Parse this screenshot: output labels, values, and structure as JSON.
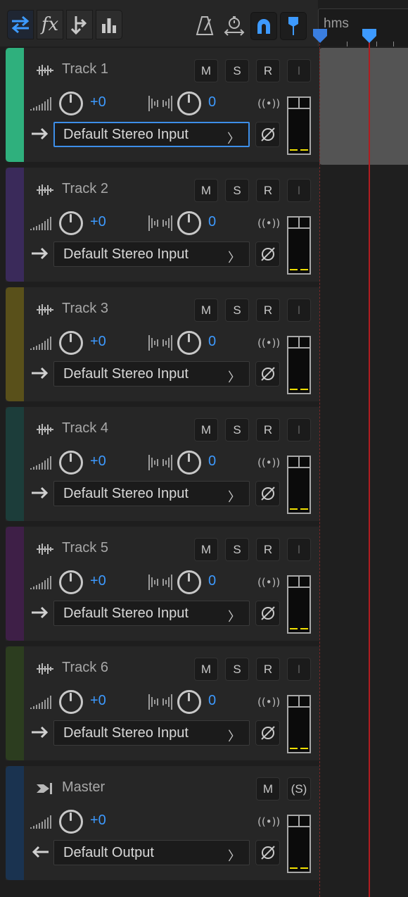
{
  "toolbar": {
    "tools": [
      {
        "name": "switch-view-icon",
        "active": true
      },
      {
        "name": "fx-icon",
        "label": "fx"
      },
      {
        "name": "sends-icon"
      },
      {
        "name": "eq-icon"
      }
    ],
    "right_tools": [
      "metronome-icon",
      "time-stretch-icon",
      "snap-magnet-icon",
      "marker-pin-icon"
    ]
  },
  "ruler": {
    "label": "hms"
  },
  "colors": {
    "accent": "#3d9aff",
    "playhead": "#b01c20",
    "meter_level": "#f0e000"
  },
  "tracks": [
    {
      "name": "Track 1",
      "color": "#2fb07d",
      "mute": "M",
      "solo": "S",
      "record": "R",
      "input_monitor": "I",
      "volume": "+0",
      "pan": "0",
      "input": "Default Stereo Input"
    },
    {
      "name": "Track 2",
      "color": "#3a2a5a",
      "mute": "M",
      "solo": "S",
      "record": "R",
      "input_monitor": "I",
      "volume": "+0",
      "pan": "0",
      "input": "Default Stereo Input"
    },
    {
      "name": "Track 3",
      "color": "#59501a",
      "mute": "M",
      "solo": "S",
      "record": "R",
      "input_monitor": "I",
      "volume": "+0",
      "pan": "0",
      "input": "Default Stereo Input"
    },
    {
      "name": "Track 4",
      "color": "#1c3d3a",
      "mute": "M",
      "solo": "S",
      "record": "R",
      "input_monitor": "I",
      "volume": "+0",
      "pan": "0",
      "input": "Default Stereo Input"
    },
    {
      "name": "Track 5",
      "color": "#3e1f47",
      "mute": "M",
      "solo": "S",
      "record": "R",
      "input_monitor": "I",
      "volume": "+0",
      "pan": "0",
      "input": "Default Stereo Input"
    },
    {
      "name": "Track 6",
      "color": "#2c3d1f",
      "mute": "M",
      "solo": "S",
      "record": "R",
      "input_monitor": "I",
      "volume": "+0",
      "pan": "0",
      "input": "Default Stereo Input"
    }
  ],
  "master": {
    "name": "Master",
    "color": "#1a3350",
    "mute": "M",
    "solo": "(S)",
    "volume": "+0",
    "output": "Default Output"
  }
}
